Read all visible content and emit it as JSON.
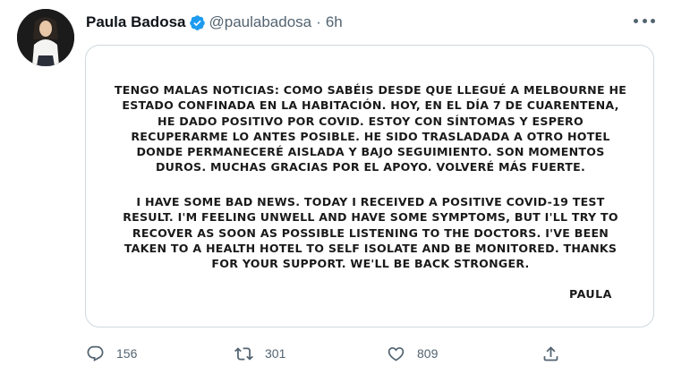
{
  "tweet": {
    "author": {
      "name": "Paula Badosa",
      "handle": "@paulabadosa",
      "separator": "·",
      "time": "6h",
      "verified": true,
      "avatar_icon": "profile-photo"
    },
    "media": {
      "statement_es": "TENGO MALAS NOTICIAS: COMO SABÉIS DESDE QUE LLEGUÉ A MELBOURNE HE ESTADO CONFINADA EN LA HABITACIÓN. HOY, EN EL DÍA 7 DE CUARENTENA, HE DADO POSITIVO POR COVID. ESTOY CON SÍNTOMAS Y ESPERO RECUPERARME LO ANTES POSIBLE. HE SIDO TRASLADADA A OTRO HOTEL DONDE PERMANECERÉ AISLADA Y BAJO SEGUIMIENTO. SON MOMENTOS DUROS. MUCHAS GRACIAS POR EL APOYO. VOLVERÉ MÁS FUERTE.",
      "statement_en": "I HAVE SOME BAD NEWS. TODAY I RECEIVED A POSITIVE COVID-19 TEST RESULT. I'M FEELING UNWELL AND HAVE SOME SYMPTOMS, BUT I'LL TRY TO RECOVER AS SOON AS POSSIBLE LISTENING TO THE DOCTORS. I'VE BEEN TAKEN TO A HEALTH HOTEL TO SELF ISOLATE AND BE MONITORED. THANKS FOR YOUR SUPPORT. WE'LL BE BACK STRONGER.",
      "signature": "PAULA"
    },
    "actions": {
      "reply_count": "156",
      "retweet_count": "301",
      "like_count": "809",
      "icons": [
        "reply-icon",
        "retweet-icon",
        "like-icon",
        "share-icon"
      ]
    }
  },
  "colors": {
    "text": "#0f1419",
    "secondary": "#536471",
    "verified_blue": "#1d9bf0",
    "border": "#cfd9de"
  }
}
